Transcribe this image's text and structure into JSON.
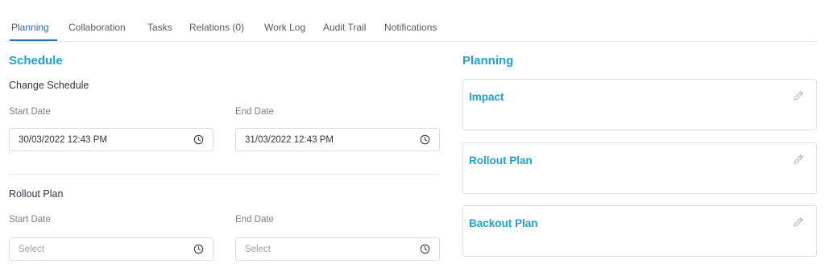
{
  "tabs": [
    {
      "label": "Planning",
      "active": true
    },
    {
      "label": "Collaboration"
    },
    {
      "label": "Tasks"
    },
    {
      "label": "Relations (0)"
    },
    {
      "label": "Work Log"
    },
    {
      "label": "Audit Trail"
    },
    {
      "label": "Notifications"
    }
  ],
  "schedule": {
    "title": "Schedule",
    "change": {
      "title": "Change Schedule",
      "start_label": "Start Date",
      "end_label": "End Date",
      "start_value": "30/03/2022 12:43 PM",
      "end_value": "31/03/2022 12:43 PM"
    },
    "rollout": {
      "title": "Rollout Plan",
      "start_label": "Start Date",
      "end_label": "End Date",
      "start_placeholder": "Select",
      "end_placeholder": "Select"
    }
  },
  "planning": {
    "title": "Planning",
    "cards": [
      {
        "title": "Impact"
      },
      {
        "title": "Rollout Plan"
      },
      {
        "title": "Backout Plan"
      }
    ]
  },
  "colors": {
    "accent": "#1ba3d6",
    "active_tab": "#2a6cb4"
  },
  "icons": {
    "field": "clock-icon",
    "card": "pencil-icon"
  }
}
